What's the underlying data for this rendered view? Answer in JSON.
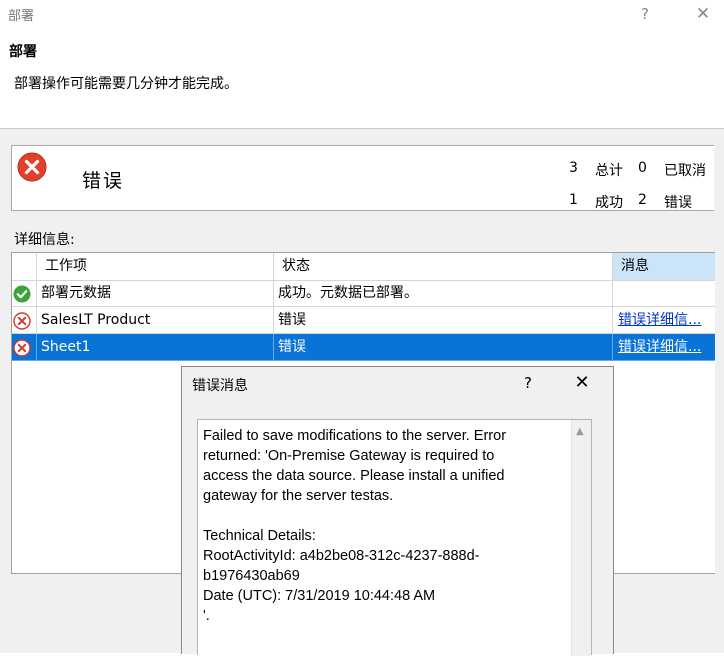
{
  "window": {
    "title": "部署",
    "help_label": "?",
    "close_label": "✕"
  },
  "header": {
    "title": "部署",
    "description": "部署操作可能需要几分钟才能完成。"
  },
  "summary": {
    "status_icon": "error-icon",
    "status_text": "错误",
    "total_count": "3",
    "total_label": "总计",
    "cancelled_count": "0",
    "cancelled_label": "已取消",
    "success_count": "1",
    "success_label": "成功",
    "error_count": "2",
    "error_label": "错误"
  },
  "details_label": "详细信息:",
  "grid": {
    "columns": [
      "工作项",
      "状态",
      "消息"
    ],
    "rows": [
      {
        "icon": "success-icon",
        "work_item": "部署元数据",
        "status": "成功。元数据已部署。",
        "message": ""
      },
      {
        "icon": "error-icon",
        "work_item": "SalesLT Product",
        "status": "错误",
        "message": "错误详细信..."
      },
      {
        "icon": "error-icon",
        "work_item": "Sheet1",
        "status": "错误",
        "message": "错误详细信..."
      }
    ]
  },
  "error_dialog": {
    "title": "错误消息",
    "help_label": "?",
    "close_label": "✕",
    "message": "Failed to save modifications to the server. Error\nreturned: 'On-Premise Gateway is required to\naccess the data source. Please install a unified\ngateway for the server testas.\n\nTechnical Details:\nRootActivityId: a4b2be08-312c-4237-888d-\nb1976430ab69\nDate (UTC): 7/31/2019 10:44:48 AM\n'."
  },
  "colors": {
    "selection": "#0a74d6",
    "error_red": "#e0412b",
    "success_green": "#3aa33a",
    "link": "#0033cc"
  }
}
